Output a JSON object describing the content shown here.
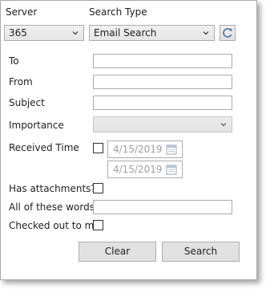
{
  "header": {
    "server_label": "Server",
    "search_type_label": "Search Type"
  },
  "server_select": {
    "value": "365"
  },
  "search_type_select": {
    "value": "Email Search"
  },
  "fields": {
    "to_label": "To",
    "from_label": "From",
    "subject_label": "Subject",
    "importance_label": "Importance",
    "received_time_label": "Received Time",
    "date_from": "4/15/2019",
    "date_to": "4/15/2019",
    "has_attachments_label": "Has attachments?",
    "all_words_label": "All of these words",
    "checked_out_label": "Checked out to me"
  },
  "buttons": {
    "clear_label": "Clear",
    "search_label": "Search"
  },
  "colors": {
    "disabled_text": "#a0a0a0",
    "border": "#acacac",
    "button_face": "#e1e1e1",
    "refresh_icon": "#5a7fa6"
  },
  "icons": {
    "refresh": "refresh-icon",
    "chevron": "chevron-down-icon",
    "calendar": "calendar-icon"
  }
}
